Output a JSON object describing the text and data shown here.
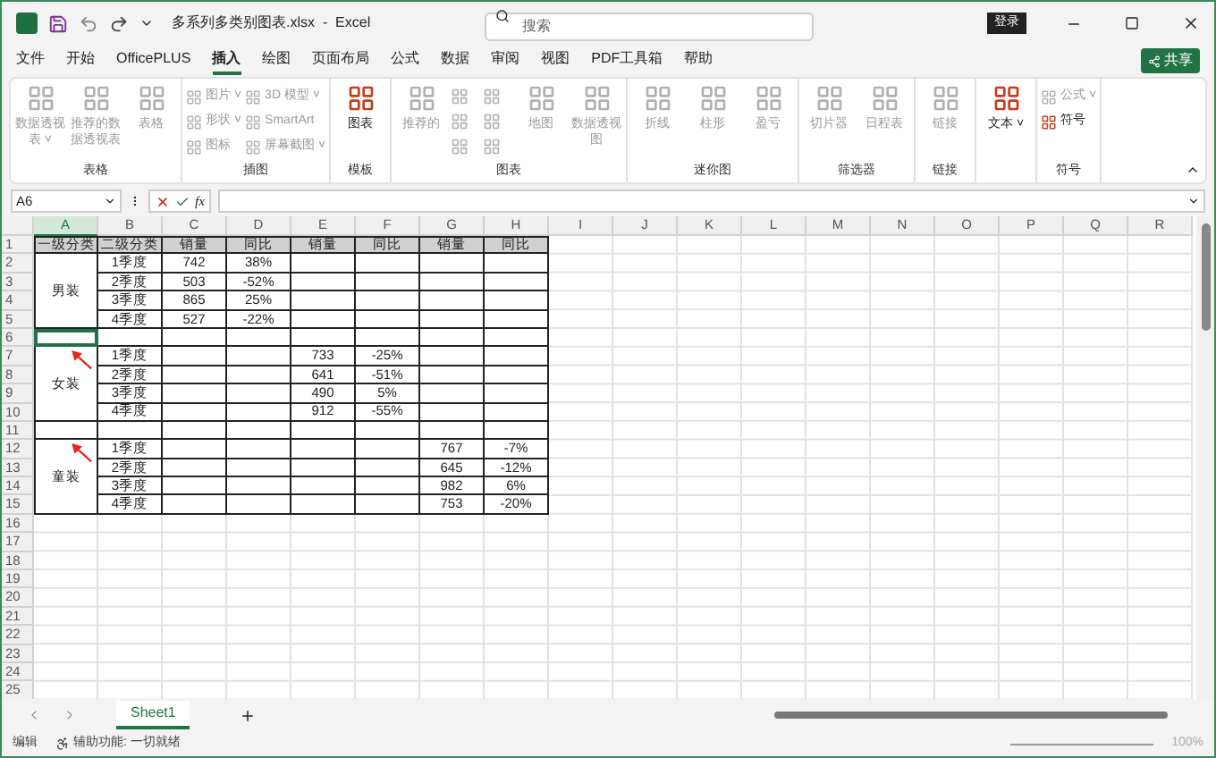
{
  "window": {
    "title": "多系列多类别图表.xlsx  -  Excel",
    "search": {
      "placeholder": "搜索"
    },
    "sign_in": "登录"
  },
  "menu": {
    "tabs": [
      {
        "label": "文件",
        "selected": false
      },
      {
        "label": "开始",
        "selected": false
      },
      {
        "label": "OfficePLUS",
        "selected": false
      },
      {
        "label": "插入",
        "selected": true
      },
      {
        "label": "绘图",
        "selected": false
      },
      {
        "label": "页面布局",
        "selected": false
      },
      {
        "label": "公式",
        "selected": false
      },
      {
        "label": "数据",
        "selected": false
      },
      {
        "label": "审阅",
        "selected": false
      },
      {
        "label": "视图",
        "selected": false
      },
      {
        "label": "PDF工具箱",
        "selected": false
      },
      {
        "label": "帮助",
        "selected": false
      }
    ],
    "share": "共享"
  },
  "ribbon": {
    "groups": [
      {
        "label": "表格",
        "items": [
          {
            "kind": "large",
            "label": "数据透视表 ˅",
            "disabled": true
          },
          {
            "kind": "large",
            "label": "推荐的数据透视表",
            "disabled": true
          },
          {
            "kind": "large",
            "label": "表格",
            "disabled": true
          }
        ]
      },
      {
        "label": "插图",
        "items": [
          {
            "kind": "small",
            "label": "图片 ˅",
            "disabled": true
          },
          {
            "kind": "small",
            "label": "形状 ˅",
            "disabled": true
          },
          {
            "kind": "small",
            "label": "图标",
            "disabled": true
          },
          {
            "kind": "small",
            "label": "3D 模型 ˅",
            "disabled": true
          },
          {
            "kind": "small",
            "label": "SmartArt",
            "disabled": true
          },
          {
            "kind": "small",
            "label": "屏幕截图 ˅",
            "disabled": true
          }
        ]
      },
      {
        "label": "模板",
        "items": [
          {
            "kind": "large",
            "label": "图表",
            "disabled": false
          }
        ]
      },
      {
        "label": "图表",
        "items": [
          {
            "kind": "large",
            "label": "推荐的",
            "disabled": true
          },
          {
            "kind": "icon",
            "disabled": true
          },
          {
            "kind": "icon",
            "disabled": true
          },
          {
            "kind": "icon",
            "disabled": true
          },
          {
            "kind": "icon",
            "disabled": true
          },
          {
            "kind": "icon",
            "disabled": true
          },
          {
            "kind": "icon",
            "disabled": true
          },
          {
            "kind": "large",
            "label": "地图",
            "disabled": true
          },
          {
            "kind": "large",
            "label": "数据透视图",
            "disabled": true
          }
        ]
      },
      {
        "label": "迷你图",
        "items": [
          {
            "kind": "large",
            "label": "折线",
            "disabled": true
          },
          {
            "kind": "large",
            "label": "柱形",
            "disabled": true
          },
          {
            "kind": "large",
            "label": "盈亏",
            "disabled": true
          }
        ]
      },
      {
        "label": "筛选器",
        "items": [
          {
            "kind": "large",
            "label": "切片器",
            "disabled": true
          },
          {
            "kind": "large",
            "label": "日程表",
            "disabled": true
          }
        ]
      },
      {
        "label": "链接",
        "items": [
          {
            "kind": "large",
            "label": "链接",
            "disabled": true
          }
        ]
      },
      {
        "items": [
          {
            "kind": "large",
            "label": "文本 ˅",
            "disabled": false
          }
        ]
      },
      {
        "label": "符号",
        "items": [
          {
            "kind": "small",
            "label": "公式 ˅",
            "disabled": true
          },
          {
            "kind": "small",
            "label": "符号",
            "disabled": false
          }
        ]
      }
    ]
  },
  "formula_bar": {
    "name_box": "A6",
    "fx": "fx"
  },
  "sheet": {
    "columns": [
      "A",
      "B",
      "C",
      "D",
      "E",
      "F",
      "G",
      "H",
      "I",
      "J",
      "K",
      "L",
      "M",
      "N",
      "O",
      "P",
      "Q",
      "R"
    ],
    "row_numbers": [
      "1",
      "2",
      "3",
      "4",
      "5",
      "6",
      "7",
      "8",
      "9",
      "10",
      "11",
      "12",
      "13",
      "14",
      "15",
      "16",
      "17",
      "18",
      "19",
      "20",
      "21",
      "22",
      "23",
      "24",
      "25"
    ],
    "header": [
      "一级分类",
      "二级分类",
      "销量",
      "同比",
      "销量",
      "同比",
      "销量",
      "同比"
    ],
    "groups": [
      {
        "category": "男装",
        "rows": [
          [
            "1季度",
            "742",
            "38%",
            "",
            "",
            "",
            ""
          ],
          [
            "2季度",
            "503",
            "-52%",
            "",
            "",
            "",
            ""
          ],
          [
            "3季度",
            "865",
            "25%",
            "",
            "",
            "",
            ""
          ],
          [
            "4季度",
            "527",
            "-22%",
            "",
            "",
            "",
            ""
          ]
        ],
        "separator_selected": true
      },
      {
        "category": "女装",
        "rows": [
          [
            "1季度",
            "",
            "",
            "733",
            "-25%",
            "",
            ""
          ],
          [
            "2季度",
            "",
            "",
            "641",
            "-51%",
            "",
            ""
          ],
          [
            "3季度",
            "",
            "",
            "490",
            "5%",
            "",
            ""
          ],
          [
            "4季度",
            "",
            "",
            "912",
            "-55%",
            "",
            ""
          ]
        ],
        "separator_selected": false
      },
      {
        "category": "童装",
        "rows": [
          [
            "1季度",
            "",
            "",
            "",
            "",
            "767",
            "-7%"
          ],
          [
            "2季度",
            "",
            "",
            "",
            "",
            "645",
            "-12%"
          ],
          [
            "3季度",
            "",
            "",
            "",
            "",
            "982",
            "6%"
          ],
          [
            "4季度",
            "",
            "",
            "",
            "",
            "753",
            "-20%"
          ]
        ]
      }
    ]
  },
  "sheet_tabs": [
    {
      "label": "Sheet1",
      "selected": true
    }
  ],
  "status_bar": {
    "mode": "编辑",
    "accessibility": "辅助功能: 一切就绪",
    "zoom": "100%"
  }
}
